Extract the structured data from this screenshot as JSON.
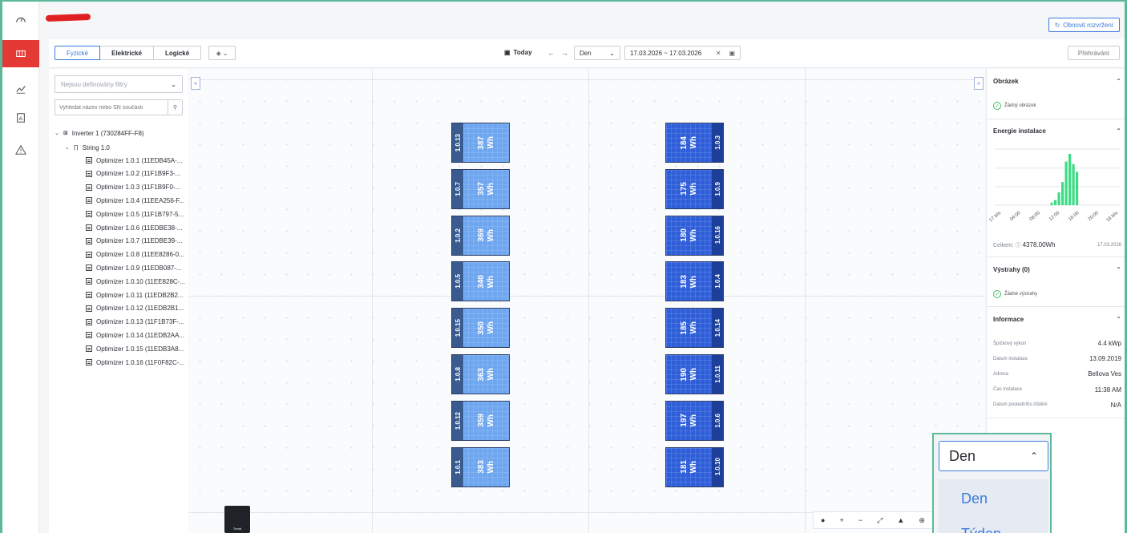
{
  "header": {
    "reset_button": "Obnovit rozvržení"
  },
  "toolbar": {
    "view_tabs": [
      "Fyzické",
      "Elektrické",
      "Logické"
    ],
    "today": "Today",
    "period": "Den",
    "date_range": "17.03.2026 ~ 17.03.2026",
    "playback": "Přehrávání"
  },
  "tree": {
    "filter_placeholder": "Nejsou definovány filtry",
    "search_placeholder": "Vyhledat název nebo SN součásti",
    "inverter": "Inverter 1 (730284FF-F8)",
    "string": "String 1.0",
    "optimizers": [
      "Optimizer 1.0.1 (11EDB45A-...",
      "Optimizer 1.0.2 (11F1B9F3-...",
      "Optimizer 1.0.3 (11F1B9F0-...",
      "Optimizer 1.0.4 (11EEA256-F...",
      "Optimizer 1.0.5 (11F1B797-5...",
      "Optimizer 1.0.6 (11EDBE38-...",
      "Optimizer 1.0.7 (11EDBE39-...",
      "Optimizer 1.0.8 (11EE8286-0...",
      "Optimizer 1.0.9 (11EDB087-...",
      "Optimizer 1.0.10 (11EE828C-...",
      "Optimizer 1.0.11 (11EDB2B2...",
      "Optimizer 1.0.12 (11EDB2B1...",
      "Optimizer 1.0.13 (11F1B73F-...",
      "Optimizer 1.0.14 (11EDB2AA...",
      "Optimizer 1.0.15 (11EDB3A8...",
      "Optimizer 1.0.16 (11F0F82C-..."
    ]
  },
  "layout_left": [
    {
      "id": "1.0.13",
      "value": "387",
      "unit": "Wh"
    },
    {
      "id": "1.0.7",
      "value": "357",
      "unit": "Wh"
    },
    {
      "id": "1.0.2",
      "value": "369",
      "unit": "Wh"
    },
    {
      "id": "1.0.5",
      "value": "340",
      "unit": "Wh"
    },
    {
      "id": "1.0.15",
      "value": "350",
      "unit": "Wh"
    },
    {
      "id": "1.0.8",
      "value": "363",
      "unit": "Wh"
    },
    {
      "id": "1.0.12",
      "value": "359",
      "unit": "Wh"
    },
    {
      "id": "1.0.1",
      "value": "383",
      "unit": "Wh"
    }
  ],
  "layout_right": [
    {
      "id": "1.0.3",
      "value": "184",
      "unit": "Wh"
    },
    {
      "id": "1.0.9",
      "value": "175",
      "unit": "Wh"
    },
    {
      "id": "1.0.16",
      "value": "180",
      "unit": "Wh"
    },
    {
      "id": "1.0.4",
      "value": "183",
      "unit": "Wh"
    },
    {
      "id": "1.0.14",
      "value": "185",
      "unit": "Wh"
    },
    {
      "id": "1.0.11",
      "value": "190",
      "unit": "Wh"
    },
    {
      "id": "1.0.6",
      "value": "197",
      "unit": "Wh"
    },
    {
      "id": "1.0.10",
      "value": "181",
      "unit": "Wh"
    }
  ],
  "canvas": {
    "trend_label": "Trend"
  },
  "right_panel": {
    "image": {
      "title": "Obrázek",
      "empty": "Žádný obrázek"
    },
    "energy": {
      "title": "Energie instalace",
      "total_label": "Celkem:",
      "total": "4378.00Wh",
      "date": "17.03.2026"
    },
    "alerts": {
      "title": "Výstrahy (0)",
      "empty": "Žádné výstrahy"
    },
    "info": {
      "title": "Informace",
      "rows": [
        {
          "k": "Špičkový výkon",
          "v": "4.4 kWp"
        },
        {
          "k": "Datum instalace",
          "v": "13.09.2019"
        },
        {
          "k": "Adresa",
          "v": "Bellova Ves"
        },
        {
          "k": "Čas instalace",
          "v": "11:38 AM"
        },
        {
          "k": "Datum posledního čištění",
          "v": "N/A"
        }
      ]
    }
  },
  "dropdown": {
    "selected": "Den",
    "options": [
      "Den",
      "Týden"
    ]
  },
  "colors": {
    "accent": "#3d7bdc",
    "alert_red": "#e53935",
    "chart_green": "#3ddc84",
    "panel_light": "#6ea6f0",
    "panel_dark": "#2f5ed9",
    "highlight": "#5db89a"
  },
  "chart_data": {
    "type": "bar",
    "categories": [
      "17 bře",
      "04:00",
      "08:00",
      "12:00",
      "16:00",
      "20:00",
      "18 bře"
    ],
    "series": [
      {
        "values": [
          0,
          0,
          0,
          0.05,
          0.1,
          0.25,
          0.45,
          0.85,
          1.0,
          0.8,
          0.65,
          0.0,
          0,
          0
        ]
      }
    ],
    "xlabel": "",
    "ylabel": "",
    "grid": true
  }
}
